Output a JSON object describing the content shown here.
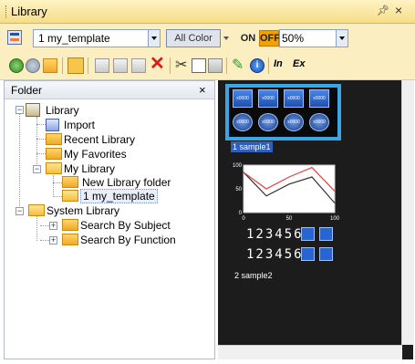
{
  "window": {
    "title": "Library",
    "pin_glyph": "ↀ",
    "close_glyph": "×"
  },
  "toolbar": {
    "template_value": "1 my_template",
    "all_color_label": "All Color",
    "on_label": "ON",
    "off_label": "OFF",
    "zoom_value": "50%",
    "text_tool_label": "In",
    "ex_tool_label": "Ex"
  },
  "folder_panel": {
    "title": "Folder",
    "close_glyph": "×",
    "tree": [
      {
        "label": "Library"
      },
      {
        "label": "Import"
      },
      {
        "label": "Recent Library"
      },
      {
        "label": "My Favorites"
      },
      {
        "label": "My Library"
      },
      {
        "label": "New Library folder"
      },
      {
        "label": "1 my_template"
      },
      {
        "label": "System Library"
      },
      {
        "label": "Search By Subject"
      },
      {
        "label": "Search By Function"
      }
    ]
  },
  "preview": {
    "sample1": {
      "label": "1 sample1",
      "square_button_text": "x0000",
      "round_button_text": "x0000"
    },
    "sample2": {
      "label": "2 sample2",
      "numeric_display_1": "123456",
      "numeric_display_2": "123456"
    },
    "chart_data": {
      "type": "line",
      "x": [
        0,
        25,
        50,
        75,
        100
      ],
      "series": [
        {
          "values": [
            85,
            35,
            60,
            75,
            20
          ],
          "color": "#ffffff"
        },
        {
          "values": [
            85,
            50,
            75,
            95,
            45
          ],
          "color": "#e04040"
        }
      ],
      "xlim": [
        0,
        100
      ],
      "ylim": [
        0,
        100
      ],
      "x_ticks": [
        "0",
        "50",
        "100"
      ],
      "y_ticks": [
        "100",
        "50",
        "0"
      ]
    }
  },
  "colors": {
    "title_bar": "#f6dd87",
    "toolbar_bg": "#fbeec1",
    "selection_frame": "#3aa6e6",
    "preview_bg": "#1c1c1c",
    "off_button": "#f5a000"
  }
}
